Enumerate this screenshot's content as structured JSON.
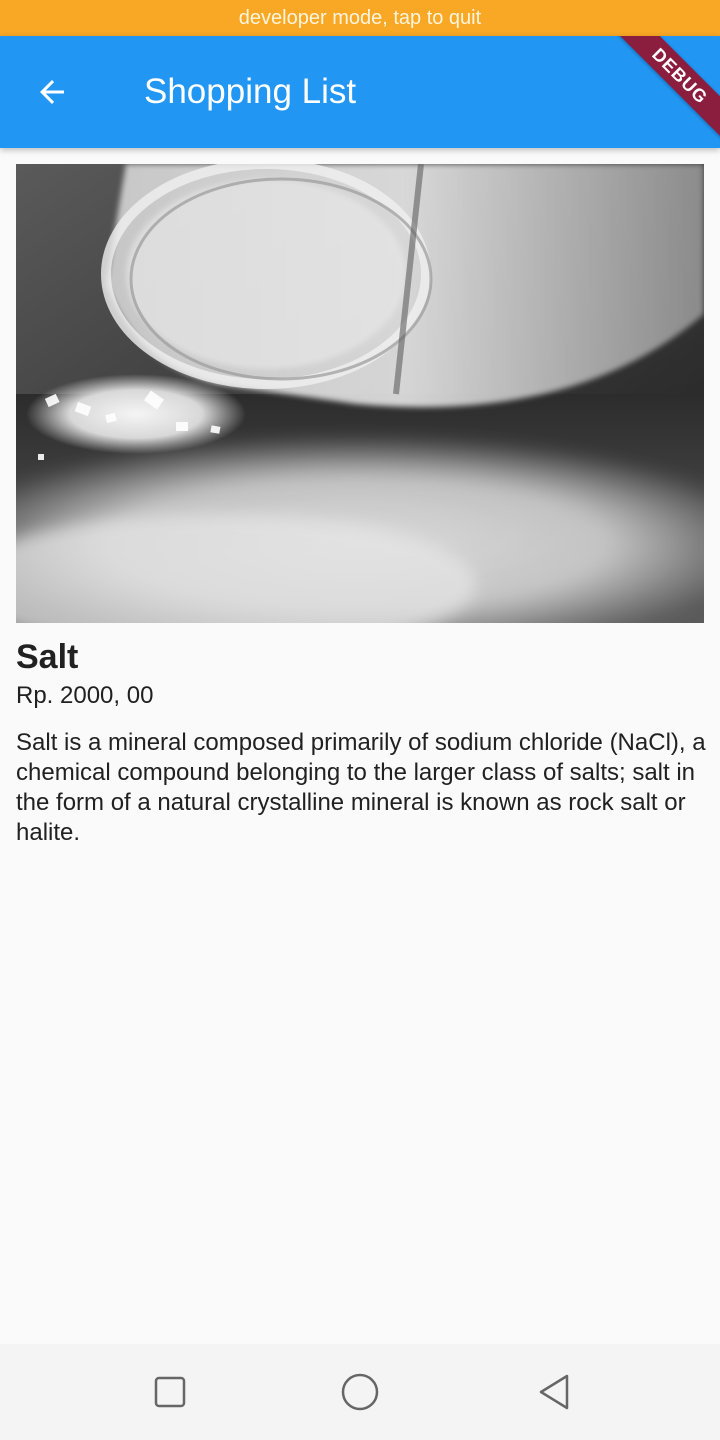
{
  "status_banner": {
    "text": "developer mode, tap to quit"
  },
  "app_bar": {
    "title": "Shopping List",
    "back_icon": "arrow-back-icon",
    "debug_label": "DEBUG"
  },
  "product": {
    "name": "Salt",
    "price": "Rp. 2000, 00",
    "description": "Salt is a mineral composed primarily of sodium chloride (NaCl), a chemical compound belonging to the larger class of salts; salt in the form of a natural crystalline mineral is known as rock salt or halite."
  },
  "nav_bar": {
    "recents_icon": "square-icon",
    "home_icon": "circle-icon",
    "back_icon": "triangle-back-icon"
  },
  "colors": {
    "banner": "#f9a825",
    "app_bar": "#2196f3",
    "debug_ribbon": "#8b1e3f",
    "background": "#fafafa",
    "text": "#212121"
  }
}
